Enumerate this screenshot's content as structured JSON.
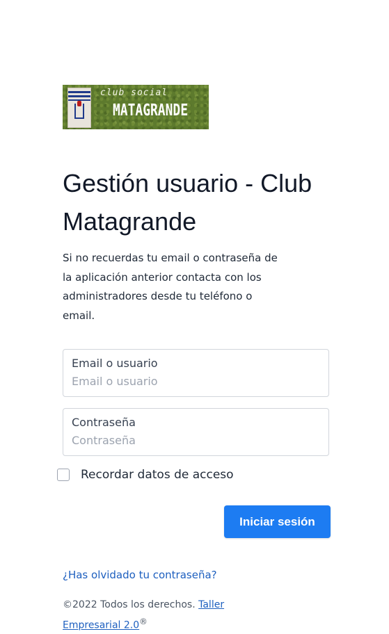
{
  "logo": {
    "line1": "club social",
    "line2": "MATAGRANDE"
  },
  "title": "Gestión usuario - Club Matagrande",
  "intro": "Si no recuerdas tu email o contraseña de la aplicación anterior contacta con los administradores desde tu teléfono o email.",
  "form": {
    "email_label": "Email o usuario",
    "email_placeholder": "Email o usuario",
    "email_value": "",
    "password_label": "Contraseña",
    "password_placeholder": "Contraseña",
    "password_value": "",
    "remember_label": "Recordar datos de acceso",
    "remember_checked": false,
    "submit_label": "Iniciar sesión"
  },
  "links": {
    "forgot_password": "¿Has olvidado tu contraseña?"
  },
  "footer": {
    "copyright": "©2022 Todos los derechos.",
    "company_link": "Taller Empresarial 2.0",
    "registered_mark": "®"
  },
  "colors": {
    "primary_button": "#1d7cf2",
    "link": "#1d5fbf",
    "logo_background": "#5d7a2d"
  }
}
